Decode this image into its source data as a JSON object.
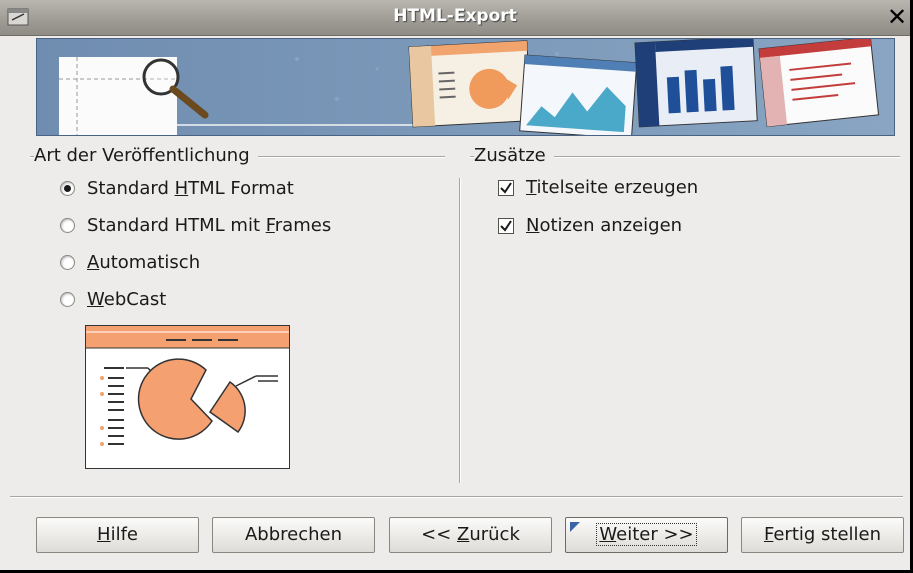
{
  "window": {
    "title": "HTML-Export"
  },
  "publication": {
    "label": "Art der Veröffentlichung",
    "options": [
      {
        "pre": "Standard ",
        "mn": "H",
        "post": "TML Format",
        "checked": true
      },
      {
        "pre": "Standard HTML mit ",
        "mn": "F",
        "post": "rames",
        "checked": false
      },
      {
        "pre": "",
        "mn": "A",
        "post": "utomatisch",
        "checked": false
      },
      {
        "pre": "",
        "mn": "W",
        "post": "ebCast",
        "checked": false
      }
    ]
  },
  "extras": {
    "label": "Zusätze",
    "options": [
      {
        "pre": "",
        "mn": "T",
        "post": "itelseite erzeugen",
        "checked": true
      },
      {
        "pre": "",
        "mn": "N",
        "post": "otizen anzeigen",
        "checked": true
      }
    ]
  },
  "buttons": {
    "help": {
      "pre": "",
      "mn": "H",
      "post": "ilfe"
    },
    "cancel": {
      "label": "Abbrechen"
    },
    "back": {
      "pre": "<< ",
      "mn": "Z",
      "post": "urück"
    },
    "next": {
      "pre": "",
      "mn": "W",
      "post": "eiter >>"
    },
    "finish": {
      "pre": "",
      "mn": "F",
      "post": "ertig stellen"
    }
  },
  "colors": {
    "accent_orange": "#f5a070",
    "banner_blue": "#6a88ab",
    "dialog_bg": "#edecea"
  },
  "icons": [
    "app-icon",
    "close-icon",
    "magnifier-icon",
    "radio-icon",
    "checkbox-check-icon"
  ]
}
